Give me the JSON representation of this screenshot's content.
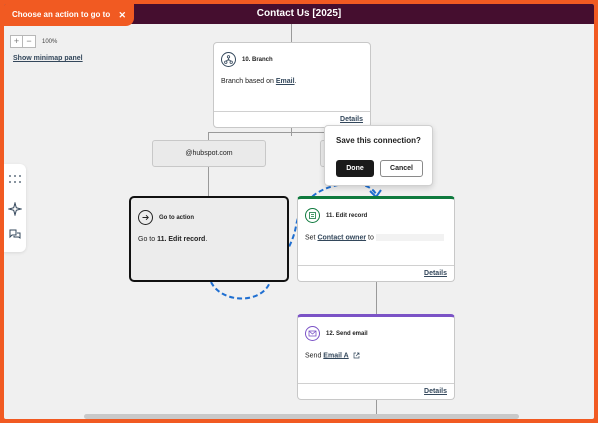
{
  "window": {
    "title": "Contact Us [2025]"
  },
  "action_picker": {
    "label": "Choose an action to go to",
    "close_glyph": "✕"
  },
  "zoom": {
    "minus_glyph": "−",
    "plus_glyph": "+",
    "level": "100%"
  },
  "minimap": {
    "link": "Show minimap panel"
  },
  "left_rail": {
    "icons": [
      "grid-dots-icon",
      "sparkle-icon",
      "comment-flag-icon"
    ]
  },
  "branch_card": {
    "title": "10. Branch",
    "body_prefix": "Branch based on ",
    "body_link": "Email",
    "body_suffix": ".",
    "details": "Details"
  },
  "branch_pill": {
    "label": "@hubspot.com"
  },
  "popover": {
    "title": "Save this connection?",
    "done": "Done",
    "cancel": "Cancel"
  },
  "goto_card": {
    "title": "Go to action",
    "body_prefix": "Go to ",
    "body_bold": "11. Edit record",
    "body_suffix": "."
  },
  "edit_card": {
    "title": "11. Edit record",
    "body_prefix": "Set ",
    "body_link": "Contact owner",
    "body_mid": " to",
    "details": "Details",
    "accent": "#0f7a3e"
  },
  "email_card": {
    "title": "12. Send email",
    "body_prefix": "Send ",
    "body_link": "Email A",
    "details": "Details",
    "accent": "#7b53c6"
  },
  "colors": {
    "brand_orange": "#f15a22",
    "header": "#450e2f",
    "connection_drag": "#1f6fd1"
  }
}
